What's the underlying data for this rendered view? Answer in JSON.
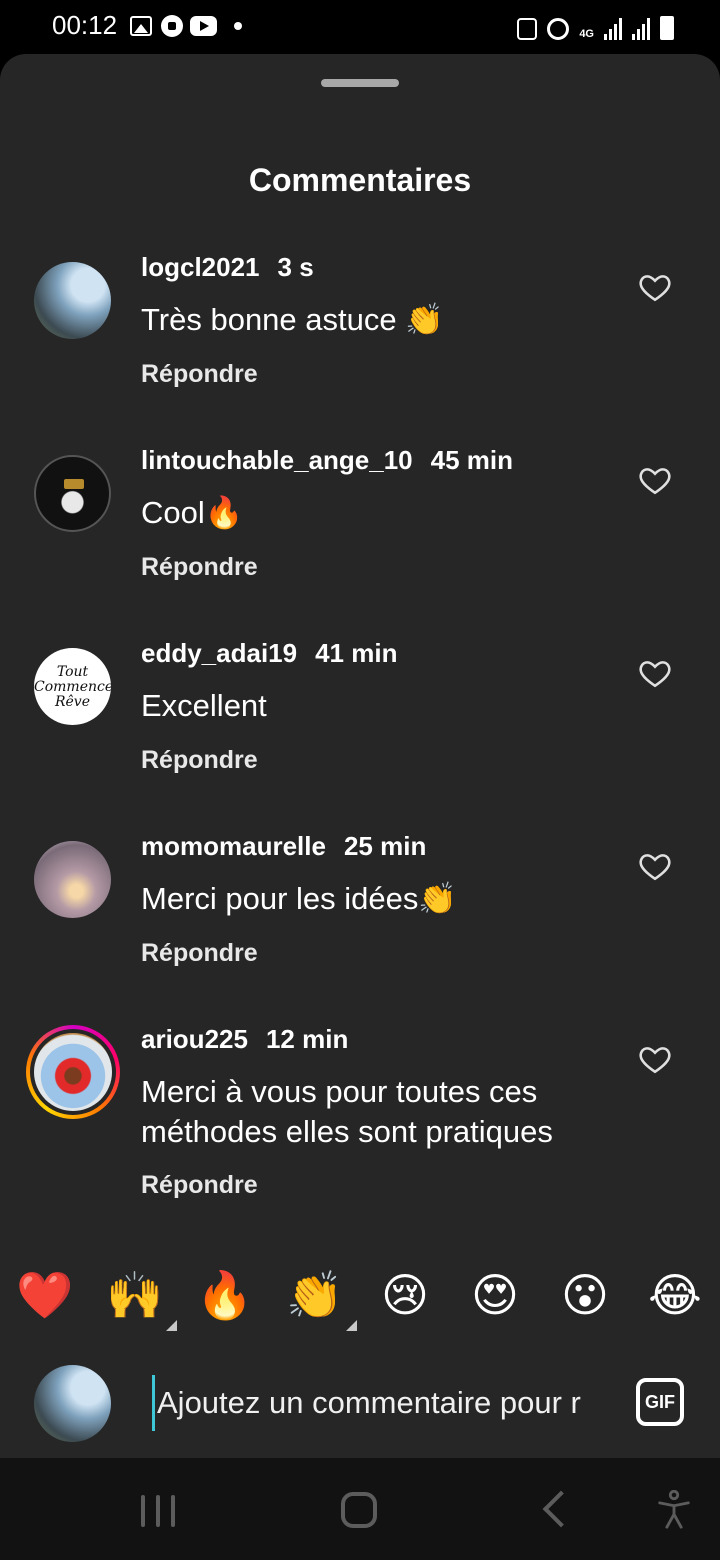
{
  "status_bar": {
    "time": "00:12",
    "left_icons": [
      "gallery-icon",
      "football-icon",
      "youtube-icon",
      "notification-dot"
    ],
    "right_icons": [
      "save-icon",
      "alarm-icon",
      "4g-icon",
      "signal-icon",
      "signal-icon",
      "battery-icon"
    ],
    "network": "4G"
  },
  "sheet": {
    "title": "Commentaires"
  },
  "comments": [
    {
      "user": "logcl2021",
      "time": "3 s",
      "text": "Très bonne astuce 👏",
      "reply": "Répondre"
    },
    {
      "user": "lintouchable_ange_10",
      "time": "45 min",
      "text": "Cool🔥",
      "reply": "Répondre"
    },
    {
      "user": "eddy_adai19",
      "time": "41 min",
      "text": "Excellent",
      "reply": "Répondre",
      "avatar_text": "Tout Commence Rêve"
    },
    {
      "user": "momomaurelle",
      "time": "25 min",
      "text": "Merci pour les idées👏",
      "reply": "Répondre"
    },
    {
      "user": "ariou225",
      "time": "12 min",
      "text": "Merci à vous pour toutes ces méthodes elles sont pratiques",
      "reply": "Répondre",
      "has_story": true
    }
  ],
  "reactions": [
    "❤️",
    "🙌",
    "🔥",
    "👏",
    "😢",
    "😍",
    "😮",
    "😂"
  ],
  "composer": {
    "placeholder": "Ajoutez un commentaire pour r",
    "gif_label": "GIF"
  },
  "colors": {
    "sheet_bg": "#262626",
    "cursor": "#3ec7d6",
    "text": "#ffffff"
  }
}
